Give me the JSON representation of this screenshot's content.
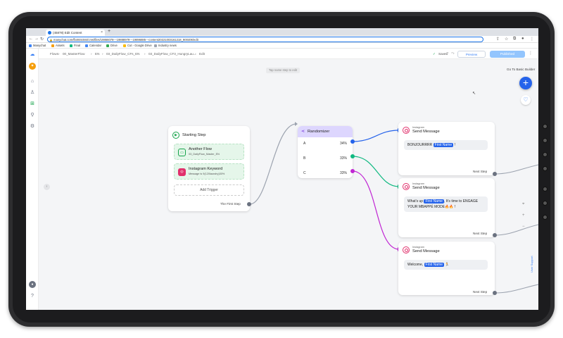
{
  "browser": {
    "tab_title": "(45878) Edit Content",
    "url": "manychat.com/fb4604484/cms/files/19866078---19888979---19896885---content20221003161218_900406/edit",
    "bookmarks": [
      "Manychat",
      "Assets",
      "Final",
      "Calendar",
      "Drive",
      "Cut - Google Drive",
      "Industry news"
    ]
  },
  "breadcrumb": [
    "Flows",
    "00_MasterFlow",
    "EN",
    "03_DailyFlow_CFs_EN",
    "03_DailyFlow_CF3_HungryLau...",
    "Edit"
  ],
  "toolbar": {
    "saved": "Saved",
    "preview": "Preview",
    "publish": "Published",
    "basic_builder": "Go To Basic Builder",
    "tap_hint": "Tap name step to edit"
  },
  "starting_step": {
    "title": "Starting Step",
    "triggers": [
      {
        "title": "Another Flow",
        "subtitle": "03_DailyFlow_Master_EN"
      },
      {
        "title": "Instagram Keyword",
        "subtitle": "Message is 9(120laundry)30%"
      }
    ],
    "add_trigger": "Add Trigger",
    "next_label": "The First Step"
  },
  "randomizer": {
    "title": "Randomizer",
    "rows": [
      {
        "letter": "A",
        "pct": "34%"
      },
      {
        "letter": "B",
        "pct": "33%"
      },
      {
        "letter": "C",
        "pct": "33%"
      }
    ]
  },
  "messages": [
    {
      "channel": "Instagram",
      "title": "Send Message",
      "before": "BONJOURRRR",
      "name": "First Name",
      "after": "!",
      "next": "Next Step"
    },
    {
      "channel": "Instagram",
      "title": "Send Message",
      "before": "What's up",
      "name": "First Name",
      "after": ", It's time to ENGAGE YOUR MBAPPÉ MODE🔥🔥 !",
      "next": "Next Step"
    },
    {
      "channel": "Instagram",
      "title": "Send Message",
      "before": "Welcome,",
      "name": "First Name",
      "after": "🏃",
      "next": "Next Step"
    }
  ],
  "side": {
    "user_support": "User Support"
  },
  "colors": {
    "accent": "#2563eb",
    "wire_a": "#2563eb",
    "wire_b": "#10b981",
    "wire_c": "#c026d3",
    "trigger_bg": "#e5f6ea",
    "randomizer_head": "#ddd6fe"
  }
}
